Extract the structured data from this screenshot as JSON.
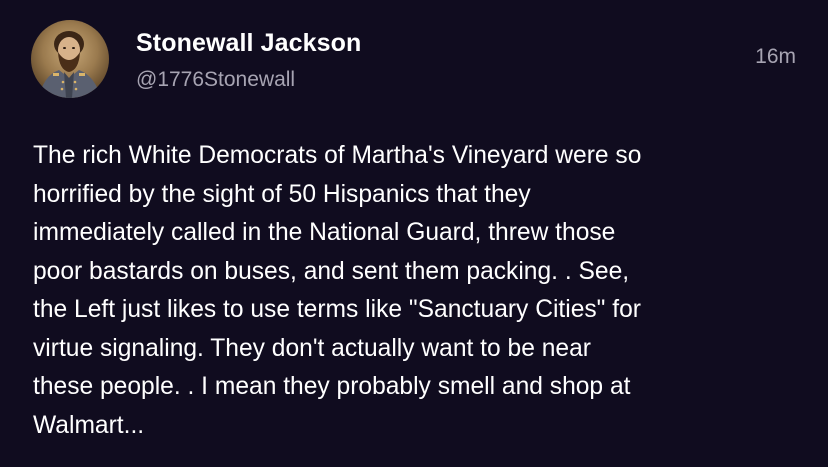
{
  "author": {
    "name": "Stonewall Jackson",
    "handle": "@1776Stonewall",
    "avatar_icon": "portrait-avatar"
  },
  "post": {
    "timestamp": "16m",
    "body_lines": [
      "The rich White Democrats of Martha's Vineyard were so",
      "horrified by the sight of 50 Hispanics that they",
      "immediately called in the National Guard, threw those",
      "poor bastards on buses, and sent them packing. . See,",
      "the Left just likes to use terms like \"Sanctuary Cities\" for",
      "virtue signaling. They don't actually want to be near",
      "these people. . I mean they probably smell and shop at",
      "Walmart..."
    ]
  },
  "colors": {
    "background": "#100c1f",
    "text_primary": "#ffffff",
    "text_secondary": "#a7a4b2"
  }
}
